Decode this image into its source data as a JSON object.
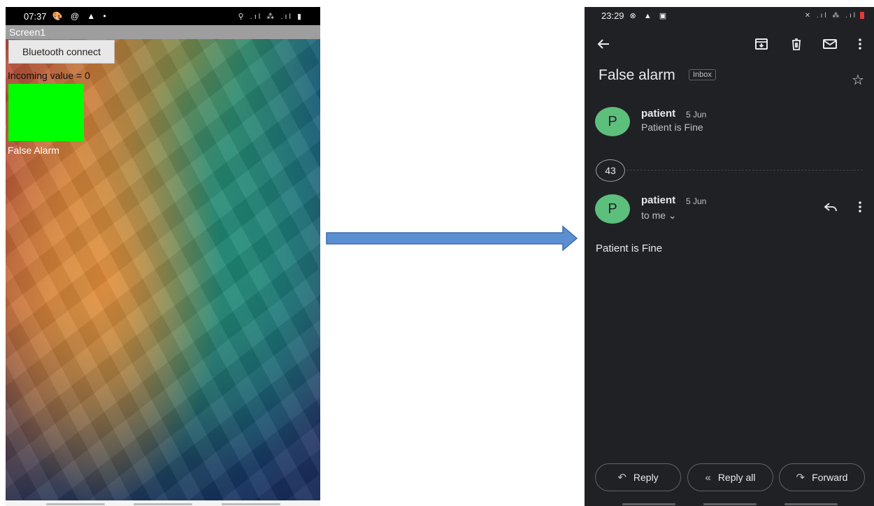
{
  "left_app": {
    "status_time": "07:37",
    "status_icons": "🎨 @ ▲ •",
    "status_right": "⚲ .ıl ⁂ .ıl ▮",
    "screen_title": "Screen1",
    "bluetooth_button": "Bluetooth connect",
    "incoming_label": "Incoming value = 0",
    "indicator_color": "#00ff00",
    "status_text": "False Alarm"
  },
  "email": {
    "status_time": "23:29",
    "status_icons": "⊗ ▲ ▣",
    "status_right": "✕ .ıl ⁂ .ıl",
    "toolbar": {
      "back_icon": "arrow-left",
      "archive_icon": "archive",
      "delete_icon": "trash",
      "mark_unread_icon": "mail",
      "more_icon": "more-vert"
    },
    "subject": "False alarm",
    "label": "Inbox",
    "messages": [
      {
        "avatar": "P",
        "sender": "patient",
        "date": "5 Jun",
        "snippet": "Patient is Fine"
      },
      {
        "avatar": "P",
        "sender": "patient",
        "date": "5 Jun",
        "recipient": "to me ⌄"
      }
    ],
    "collapsed_count": "43",
    "body": "Patient is Fine",
    "actions": {
      "reply": "Reply",
      "reply_all": "Reply all",
      "forward": "Forward"
    },
    "avatar_color": "#5cbf7c"
  },
  "arrow_color": "#5b8fd1"
}
